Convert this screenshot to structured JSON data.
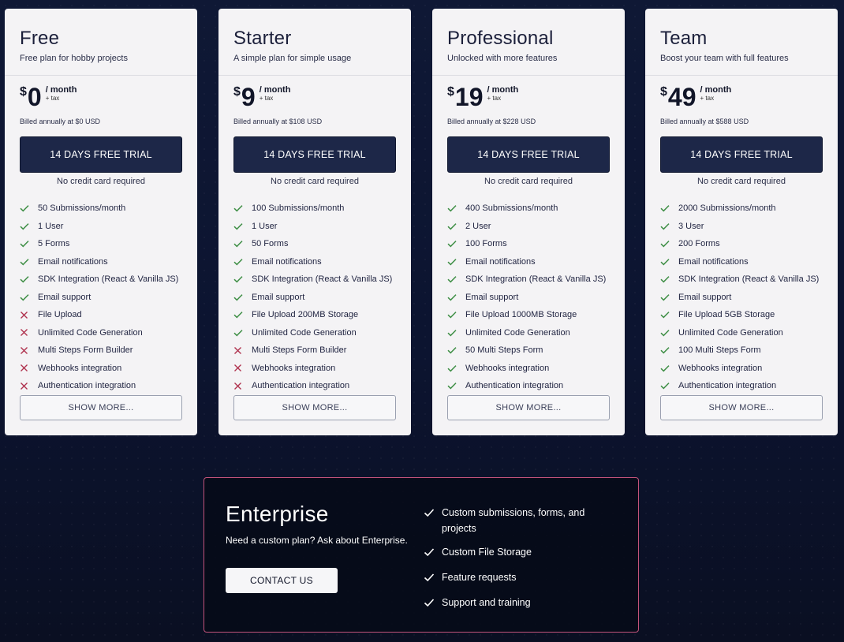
{
  "colors": {
    "check": "#3f8f46",
    "cross": "#b0334f",
    "enterprise_border": "#c2537a"
  },
  "plans": [
    {
      "name": "Free",
      "description": "Free plan for hobby projects",
      "currency": "$",
      "amount": "0",
      "per": "/ month",
      "tax": "+ tax",
      "billed": "Billed annually at $0 USD",
      "trial_label": "14 DAYS FREE TRIAL",
      "no_cc": "No credit card required",
      "features": [
        {
          "text": "50 Submissions/month",
          "included": true
        },
        {
          "text": "1 User",
          "included": true
        },
        {
          "text": "5 Forms",
          "included": true
        },
        {
          "text": "Email notifications",
          "included": true
        },
        {
          "text": "SDK Integration (React & Vanilla JS)",
          "included": true
        },
        {
          "text": "Email support",
          "included": true
        },
        {
          "text": "File Upload",
          "included": false
        },
        {
          "text": "Unlimited Code Generation",
          "included": false
        },
        {
          "text": "Multi Steps Form Builder",
          "included": false
        },
        {
          "text": "Webhooks integration",
          "included": false
        },
        {
          "text": "Authentication integration",
          "included": false
        }
      ],
      "show_more": "SHOW MORE..."
    },
    {
      "name": "Starter",
      "description": "A simple plan for simple usage",
      "currency": "$",
      "amount": "9",
      "per": "/ month",
      "tax": "+ tax",
      "billed": "Billed annually at $108 USD",
      "trial_label": "14 DAYS FREE TRIAL",
      "no_cc": "No credit card required",
      "features": [
        {
          "text": "100 Submissions/month",
          "included": true
        },
        {
          "text": "1 User",
          "included": true
        },
        {
          "text": "50 Forms",
          "included": true
        },
        {
          "text": "Email notifications",
          "included": true
        },
        {
          "text": "SDK Integration (React & Vanilla JS)",
          "included": true
        },
        {
          "text": "Email support",
          "included": true
        },
        {
          "text": "File Upload 200MB Storage",
          "included": true
        },
        {
          "text": "Unlimited Code Generation",
          "included": true
        },
        {
          "text": "Multi Steps Form Builder",
          "included": false
        },
        {
          "text": "Webhooks integration",
          "included": false
        },
        {
          "text": "Authentication integration",
          "included": false
        }
      ],
      "show_more": "SHOW MORE..."
    },
    {
      "name": "Professional",
      "description": "Unlocked with more features",
      "currency": "$",
      "amount": "19",
      "per": "/ month",
      "tax": "+ tax",
      "billed": "Billed annually at $228 USD",
      "trial_label": "14 DAYS FREE TRIAL",
      "no_cc": "No credit card required",
      "features": [
        {
          "text": "400 Submissions/month",
          "included": true
        },
        {
          "text": "2 User",
          "included": true
        },
        {
          "text": "100 Forms",
          "included": true
        },
        {
          "text": "Email notifications",
          "included": true
        },
        {
          "text": "SDK Integration (React & Vanilla JS)",
          "included": true
        },
        {
          "text": "Email support",
          "included": true
        },
        {
          "text": "File Upload 1000MB Storage",
          "included": true
        },
        {
          "text": "Unlimited Code Generation",
          "included": true
        },
        {
          "text": "50 Multi Steps Form",
          "included": true
        },
        {
          "text": "Webhooks integration",
          "included": true
        },
        {
          "text": "Authentication integration",
          "included": true
        }
      ],
      "show_more": "SHOW MORE..."
    },
    {
      "name": "Team",
      "description": "Boost your team with full features",
      "currency": "$",
      "amount": "49",
      "per": "/ month",
      "tax": "+ tax",
      "billed": "Billed annually at $588 USD",
      "trial_label": "14 DAYS FREE TRIAL",
      "no_cc": "No credit card required",
      "features": [
        {
          "text": "2000 Submissions/month",
          "included": true
        },
        {
          "text": "3 User",
          "included": true
        },
        {
          "text": "200 Forms",
          "included": true
        },
        {
          "text": "Email notifications",
          "included": true
        },
        {
          "text": "SDK Integration (React & Vanilla JS)",
          "included": true
        },
        {
          "text": "Email support",
          "included": true
        },
        {
          "text": "File Upload 5GB Storage",
          "included": true
        },
        {
          "text": "Unlimited Code Generation",
          "included": true
        },
        {
          "text": "100 Multi Steps Form",
          "included": true
        },
        {
          "text": "Webhooks integration",
          "included": true
        },
        {
          "text": "Authentication integration",
          "included": true
        }
      ],
      "show_more": "SHOW MORE..."
    }
  ],
  "enterprise": {
    "title": "Enterprise",
    "description": "Need a custom plan? Ask about Enterprise.",
    "contact_label": "CONTACT US",
    "features": [
      "Custom submissions, forms, and projects",
      "Custom File Storage",
      "Feature requests",
      "Support and training"
    ]
  }
}
